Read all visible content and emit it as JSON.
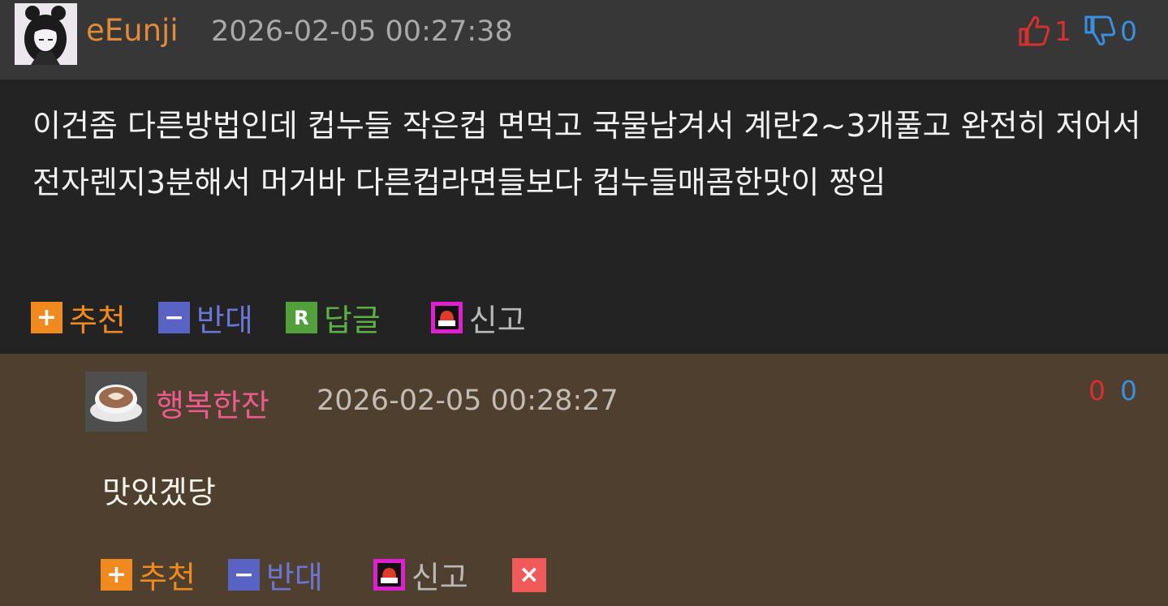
{
  "main_comment": {
    "username": "eEunji",
    "timestamp": "2026-02-05 00:27:38",
    "upvotes": "1",
    "downvotes": "0",
    "text": "이건좀 다른방법인데 컵누들 작은컵 면먹고 국물남겨서 계란2~3개풀고 완전히 저어서 전자렌지3분해서 머거바 다른컵라면들보다 컵누들매콤한맛이 짱임",
    "actions": {
      "recommend": "추천",
      "oppose": "반대",
      "reply": "답글",
      "report": "신고"
    }
  },
  "reply_comment": {
    "username": "행복한잔",
    "timestamp": "2026-02-05 00:28:27",
    "upvotes": "0",
    "downvotes": "0",
    "text": "맛있겠당",
    "actions": {
      "recommend": "추천",
      "oppose": "반대",
      "report": "신고"
    }
  },
  "icons": {
    "recommend": "plus-icon",
    "oppose": "minus-icon",
    "reply": "reply-r-icon",
    "report": "siren-icon",
    "delete": "close-icon",
    "thumb_up": "thumbs-up-icon",
    "thumb_down": "thumbs-down-icon"
  },
  "colors": {
    "header_bg": "#373737",
    "body_bg": "#232323",
    "reply_bg": "#4f3f2e",
    "username_main": "#e08a3a",
    "username_reply": "#ec5b8d",
    "recommend": "#f08a1e",
    "oppose": "#5863c4",
    "reply": "#51a03c",
    "report_icon": "#e020d0",
    "delete": "#f05a5a",
    "upvote": "#d8302e",
    "downvote": "#3a8fe0"
  }
}
